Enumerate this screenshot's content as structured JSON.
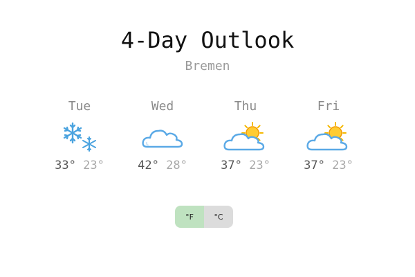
{
  "header": {
    "title": "4-Day Outlook",
    "city": "Bremen"
  },
  "forecast": [
    {
      "day": "Tue",
      "icon": "snowflake-icon",
      "high": "33°",
      "low": "23°"
    },
    {
      "day": "Wed",
      "icon": "cloud-icon",
      "high": "42°",
      "low": "28°"
    },
    {
      "day": "Thu",
      "icon": "partly-sunny-icon",
      "high": "37°",
      "low": "23°"
    },
    {
      "day": "Fri",
      "icon": "partly-sunny-icon",
      "high": "37°",
      "low": "23°"
    }
  ],
  "units": {
    "fahrenheit_label": "°F",
    "celsius_label": "°C",
    "selected": "°F"
  },
  "colors": {
    "selected_unit_bg": "#bfe2c0",
    "unselected_unit_bg": "#dcdcdc",
    "snow": "#4aa3df",
    "sun": "#f5b800",
    "cloud_outline": "#5aa9e6"
  }
}
